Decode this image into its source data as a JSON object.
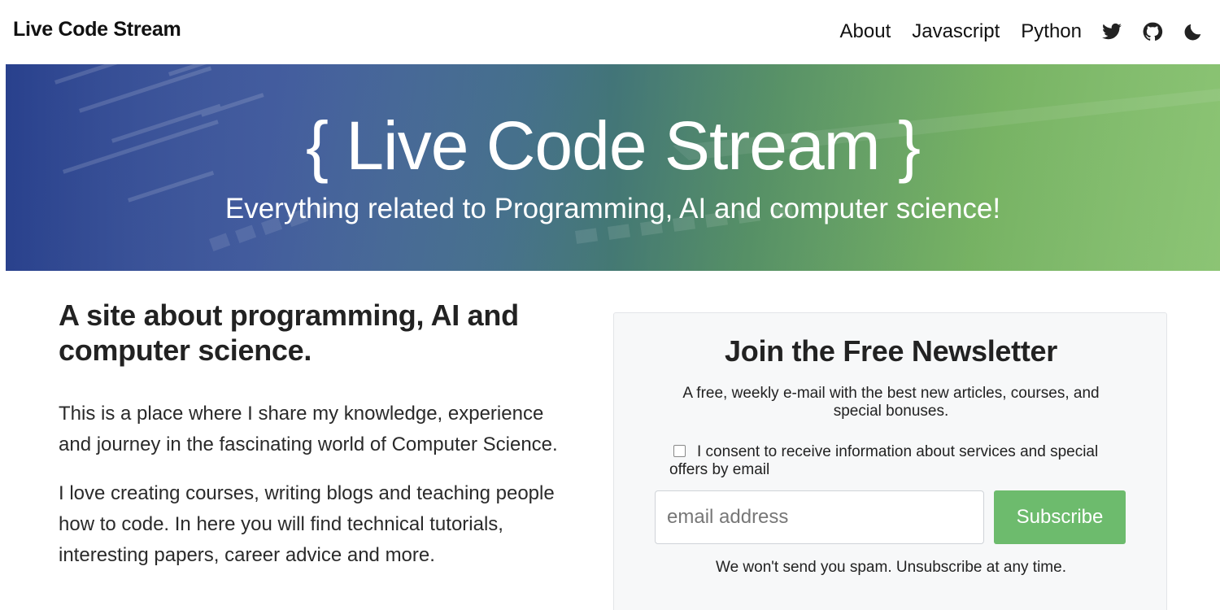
{
  "nav": {
    "brand": "Live Code Stream",
    "links": [
      "About",
      "Javascript",
      "Python"
    ],
    "icons": [
      "twitter-icon",
      "github-icon",
      "moon-icon"
    ]
  },
  "hero": {
    "title": "{ Live Code Stream }",
    "subtitle": "Everything related to Programming, AI and computer science!",
    "gradient_colors": [
      "#2f4a9c",
      "#7dbb66"
    ]
  },
  "intro": {
    "heading": "A site about programming, AI and computer science.",
    "paragraphs": [
      "This is a place where I share my knowledge, experience and journey in the fascinating world of Computer Science.",
      "I love creating courses, writing blogs and teaching people how to code. In here you will find technical tutorials, interesting papers, career advice and more."
    ]
  },
  "newsletter": {
    "title": "Join the Free Newsletter",
    "description": "A free, weekly e-mail with the best new articles, courses, and special bonuses.",
    "consent": "I consent to receive information about services and special offers by email",
    "email_placeholder": "email address",
    "subscribe_label": "Subscribe",
    "footnote": "We won't send you spam. Unsubscribe at any time.",
    "button_color": "#6dbb6d"
  }
}
